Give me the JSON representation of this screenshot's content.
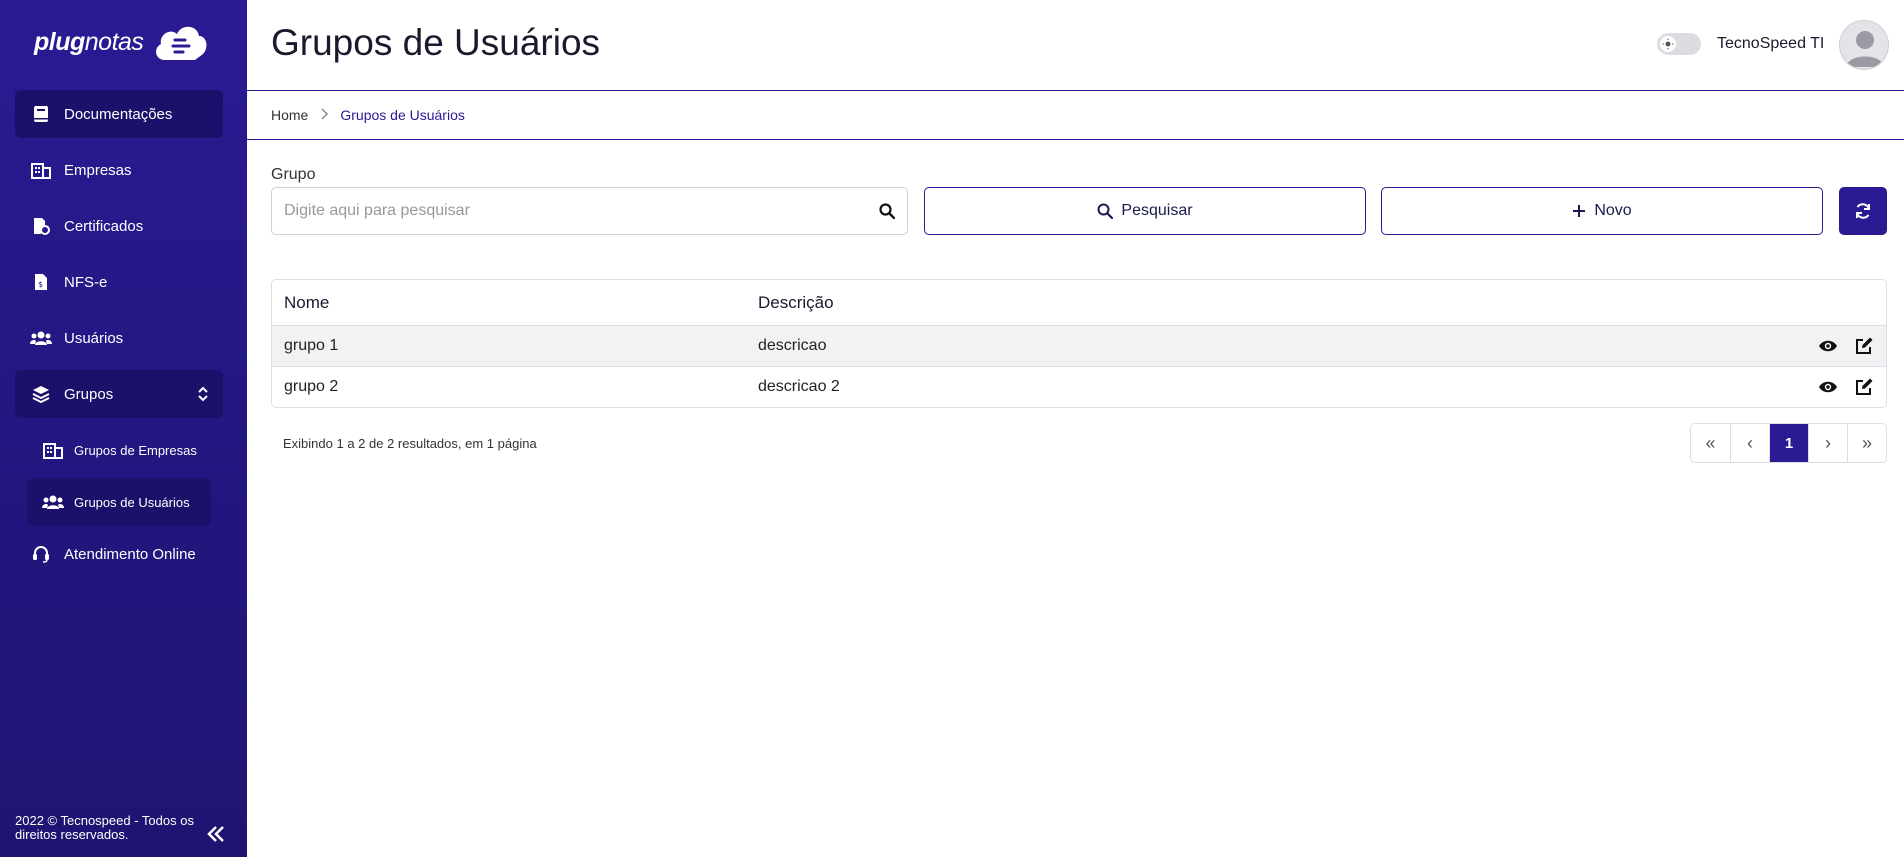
{
  "brand": {
    "logo_bold": "plug",
    "logo_rest": "notas"
  },
  "sidebar": {
    "items": [
      {
        "label": "Documentações",
        "icon": "book-icon"
      },
      {
        "label": "Empresas",
        "icon": "building-icon"
      },
      {
        "label": "Certificados",
        "icon": "certificate-icon"
      },
      {
        "label": "NFS-e",
        "icon": "file-invoice-icon"
      },
      {
        "label": "Usuários",
        "icon": "users-icon"
      },
      {
        "label": "Grupos",
        "icon": "layers-icon"
      }
    ],
    "sub_items": [
      {
        "label": "Grupos de Empresas",
        "icon": "building-icon"
      },
      {
        "label": "Grupos de Usuários",
        "icon": "users-icon"
      }
    ],
    "support": {
      "label": "Atendimento Online",
      "icon": "headset-icon"
    },
    "footer": "2022 © Tecnospeed - Todos os direitos reservados."
  },
  "header": {
    "title": "Grupos de Usuários",
    "user_name": "TecnoSpeed TI"
  },
  "breadcrumb": {
    "home": "Home",
    "current": "Grupos de Usuários"
  },
  "filter": {
    "label": "Grupo",
    "placeholder": "Digite aqui para pesquisar",
    "search_button": "Pesquisar",
    "new_button": "Novo"
  },
  "table": {
    "columns": [
      "Nome",
      "Descrição"
    ],
    "rows": [
      {
        "name": "grupo 1",
        "description": "descricao"
      },
      {
        "name": "grupo 2",
        "description": "descricao 2"
      }
    ]
  },
  "results": {
    "info": "Exibindo 1 a 2 de 2 resultados, em 1 página"
  },
  "pagination": {
    "first": "«",
    "prev": "‹",
    "current": "1",
    "next": "›",
    "last": "»"
  },
  "colors": {
    "primary": "#2a1b93",
    "sidebar_active": "#1b116a"
  }
}
